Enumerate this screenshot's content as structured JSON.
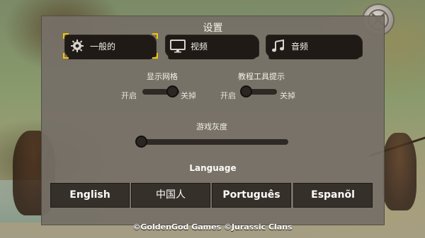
{
  "settings": {
    "title": "设置"
  },
  "tabs": [
    {
      "label": "一般的",
      "icon": "gear-icon",
      "selected": true
    },
    {
      "label": "视频",
      "icon": "monitor-icon",
      "selected": false
    },
    {
      "label": "音频",
      "icon": "music-note-icon",
      "selected": false
    }
  ],
  "general": {
    "grid": {
      "label": "显示网格",
      "off_label": "开启",
      "on_label": "关掉",
      "value": 1.0
    },
    "tooltips": {
      "label": "教程工具提示",
      "off_label": "开启",
      "on_label": "关掉",
      "value": 0.0
    },
    "gray": {
      "label": "游戏灰度",
      "value": 0.0
    }
  },
  "language": {
    "title": "Language",
    "options": [
      "English",
      "中国人",
      "Português",
      "Espanõl"
    ]
  },
  "footer": {
    "copyright": "©GoldenGod Games ©Jurassic Clans"
  },
  "colors": {
    "selected_outline": "#f5c400",
    "panel": "#766f66",
    "tab": "#1f1a16"
  }
}
